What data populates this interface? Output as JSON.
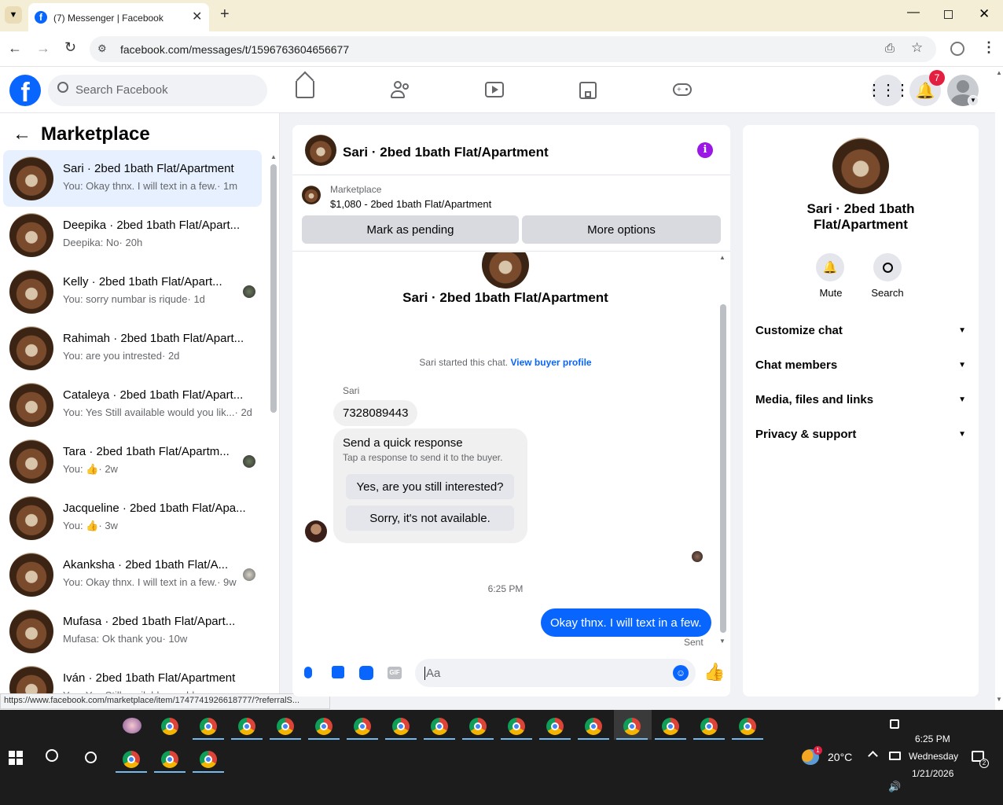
{
  "browser": {
    "tab_title": "(7) Messenger | Facebook",
    "url": "facebook.com/messages/t/1596763604656677",
    "status_url": "https://www.facebook.com/marketplace/item/1747741926618777/?referralS..."
  },
  "header": {
    "search_placeholder": "Search Facebook",
    "notification_count": "7"
  },
  "sidebar": {
    "title": "Marketplace",
    "conversations": [
      {
        "name": "Sari · 2bed 1bath Flat/Apartment",
        "preview": "You: Okay thnx. I will text in a few.",
        "time": "· 1m"
      },
      {
        "name": "Deepika · 2bed 1bath Flat/Apart...",
        "preview": "Deepika: No",
        "time": "· 20h"
      },
      {
        "name": "Kelly · 2bed 1bath Flat/Apart...",
        "preview": "You: sorry numbar is riqude",
        "time": "· 1d"
      },
      {
        "name": "Rahimah · 2bed 1bath Flat/Apart...",
        "preview": "You: are you intrested",
        "time": "· 2d"
      },
      {
        "name": "Cataleya · 2bed 1bath Flat/Apart...",
        "preview": "You: Yes Still available would you lik...",
        "time": "· 2d"
      },
      {
        "name": "Tara · 2bed 1bath Flat/Apartm...",
        "preview": "You:",
        "time": "· 2w"
      },
      {
        "name": "Jacqueline · 2bed 1bath Flat/Apa...",
        "preview": "You:",
        "time": "· 3w"
      },
      {
        "name": "Akanksha · 2bed 1bath Flat/A...",
        "preview": "You: Okay thnx. I will text in a few.",
        "time": "· 9w"
      },
      {
        "name": "Mufasa · 2bed 1bath Flat/Apart...",
        "preview": "Mufasa: Ok thank you",
        "time": "· 10w"
      },
      {
        "name": "Iván · 2bed 1bath Flat/Apartment",
        "preview": "You: Yes Still available would you...",
        "time": ""
      }
    ]
  },
  "chat": {
    "title": "Sari · 2bed 1bath Flat/Apartment",
    "listing_label": "Marketplace",
    "listing_price": "$1,080 - 2bed 1bath Flat/Apartment",
    "mark_pending": "Mark as pending",
    "more_options": "More options",
    "profile_name": "Sari · 2bed 1bath Flat/Apartment",
    "started_text": "Sari started this chat.",
    "view_profile": "View buyer profile",
    "sender": "Sari",
    "phone_msg": "7328089443",
    "quick_title": "Send a quick response",
    "quick_sub": "Tap a response to send it to the buyer.",
    "quick_1": "Yes, are you still interested?",
    "quick_2": "Sorry, it's not available.",
    "timestamp": "6:25 PM",
    "my_msg": "Okay thnx. I will text in a few.",
    "sent": "Sent",
    "composer_placeholder": "Aa"
  },
  "details": {
    "name": "Sari · 2bed 1bath Flat/Apartment",
    "mute": "Mute",
    "search": "Search",
    "sections": [
      "Customize chat",
      "Chat members",
      "Media, files and links",
      "Privacy & support"
    ]
  },
  "taskbar": {
    "time": "6:25 PM",
    "day": "Wednesday",
    "date": "1/21/2026",
    "temp": "20°C",
    "notif_count": "2",
    "weather_badge": "1"
  },
  "colors": {
    "accent": "#0866ff",
    "selected_row": "#e7f0fe",
    "badge": "#e41e3f"
  }
}
